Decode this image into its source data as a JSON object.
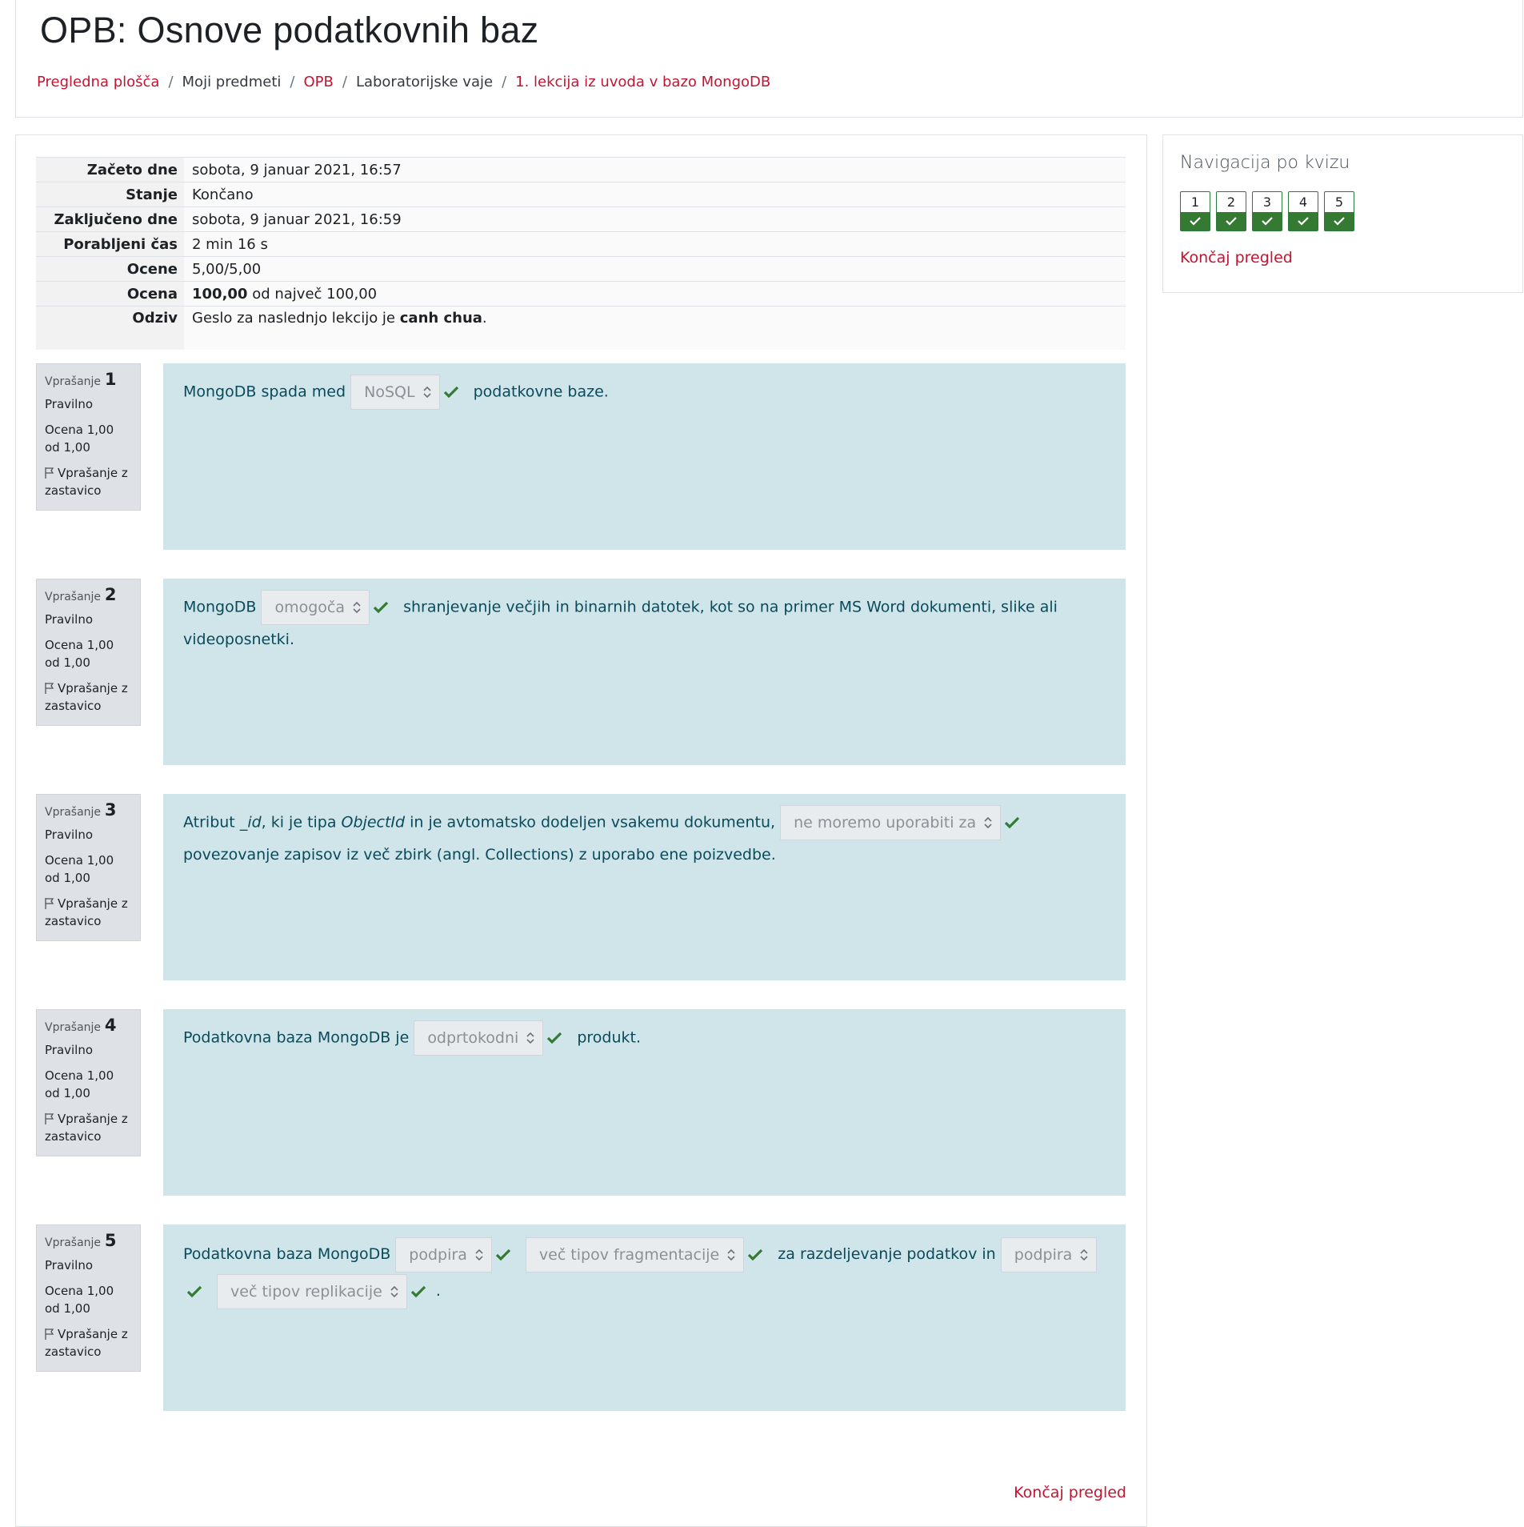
{
  "header": {
    "title": "OPB: Osnove podatkovnih baz",
    "breadcrumb": [
      {
        "label": "Pregledna plošča",
        "link": true
      },
      {
        "label": "Moji predmeti",
        "link": false
      },
      {
        "label": "OPB",
        "link": true
      },
      {
        "label": "Laboratorijske vaje",
        "link": false
      },
      {
        "label": "1. lekcija iz uvoda v bazo MongoDB",
        "link": true
      }
    ]
  },
  "summary": {
    "started_label": "Začeto dne",
    "started_value": "sobota, 9 januar 2021, 16:57",
    "state_label": "Stanje",
    "state_value": "Končano",
    "completed_label": "Zaključeno dne",
    "completed_value": "sobota, 9 januar 2021, 16:59",
    "time_label": "Porabljeni čas",
    "time_value": "2 min 16 s",
    "marks_label": "Ocene",
    "marks_value": "5,00/5,00",
    "grade_label": "Ocena",
    "grade_score": "100,00",
    "grade_rest": "od največ 100,00",
    "feedback_label": "Odziv",
    "feedback_text": "Geslo za naslednjo lekcijo je",
    "feedback_password": "canh chua",
    "feedback_end": "."
  },
  "question_labels": {
    "question": "Vprašanje",
    "state": "Pravilno",
    "grade": "Ocena 1,00 od 1,00",
    "flag": "Vprašanje z zastavico"
  },
  "questions": [
    {
      "number": "1",
      "parts": [
        "MongoDB spada med",
        "podatkovne baze."
      ],
      "selects": [
        "NoSQL"
      ]
    },
    {
      "number": "2",
      "parts": [
        "MongoDB",
        "shranjevanje večjih in binarnih datotek, kot so na primer MS Word dokumenti, slike ali videoposnetki."
      ],
      "selects": [
        "omogoča"
      ]
    },
    {
      "number": "3",
      "parts": [
        "Atribut",
        "_id",
        ", ki je tipa",
        "ObjectId",
        "in je avtomatsko dodeljen vsakemu dokumentu,",
        "povezovanje zapisov iz več zbirk (angl. Collections) z uporabo ene poizvedbe."
      ],
      "selects": [
        "ne moremo uporabiti za"
      ]
    },
    {
      "number": "4",
      "parts": [
        "Podatkovna baza MongoDB je",
        "produkt."
      ],
      "selects": [
        "odprtokodni"
      ]
    },
    {
      "number": "5",
      "parts": [
        "Podatkovna baza MongoDB",
        "za razdeljevanje podatkov in",
        "."
      ],
      "selects": [
        "podpira",
        "več tipov fragmentacije",
        "podpira",
        "več tipov replikacije"
      ]
    }
  ],
  "navigation": {
    "title": "Navigacija po kvizu",
    "buttons": [
      "1",
      "2",
      "3",
      "4",
      "5"
    ],
    "finish": "Končaj pregled"
  },
  "footer": {
    "finish": "Končaj pregled"
  },
  "colors": {
    "link": "#c31432",
    "correct": "#357a32",
    "question_bg": "#cfe5ea"
  }
}
